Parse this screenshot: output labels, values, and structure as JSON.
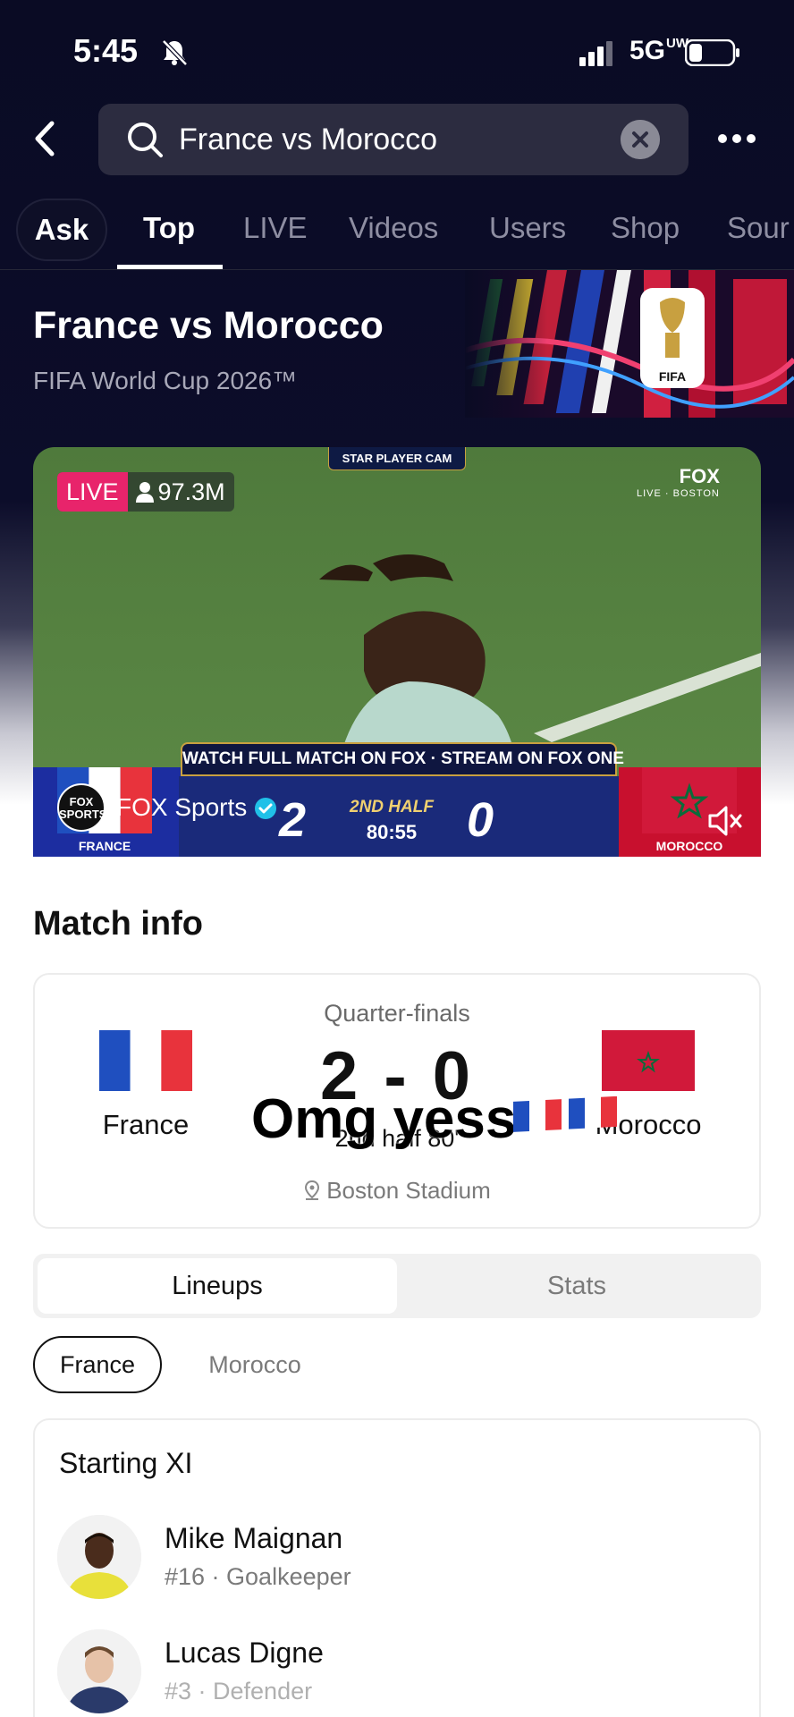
{
  "status_bar": {
    "time": "5:45",
    "network": "5G",
    "network_sup": "UW"
  },
  "search": {
    "query": "France vs Morocco"
  },
  "tabs": [
    {
      "label": "Ask"
    },
    {
      "label": "Top"
    },
    {
      "label": "LIVE"
    },
    {
      "label": "Videos"
    },
    {
      "label": "Users"
    },
    {
      "label": "Shop"
    },
    {
      "label": "Sour"
    }
  ],
  "event": {
    "title": "France vs Morocco",
    "subtitle": "FIFA World Cup 2026™",
    "banner_label": "FIFA"
  },
  "live_video": {
    "live_label": "LIVE",
    "viewers": "97.3M",
    "cam_label": "STAR PLAYER CAM",
    "broadcaster_corner": "FOX",
    "broadcaster_corner_sub": "LIVE · BOSTON",
    "watch_banner": "WATCH FULL MATCH ON FOX · STREAM ON FOX ONE",
    "home_score": "2",
    "away_score": "0",
    "period": "2ND HALF",
    "clock": "80:55",
    "home_team": "FRANCE",
    "away_team": "MOROCCO",
    "channel_logo": "FOX SPORTS",
    "channel_name": "FOX Sports"
  },
  "match_info": {
    "title": "Match info",
    "round": "Quarter-finals",
    "home_team": "France",
    "away_team": "Morocco",
    "score": "2 - 0",
    "status": "2nd half 80'",
    "venue": "Boston Stadium",
    "comment_overlay": "Omg yess"
  },
  "segments": {
    "active": "Lineups",
    "inactive": "Stats"
  },
  "team_chips": {
    "active": "France",
    "inactive": "Morocco"
  },
  "lineup": {
    "title": "Starting XI",
    "players": [
      {
        "name": "Mike Maignan",
        "meta": "#16 · Goalkeeper"
      },
      {
        "name": "Lucas Digne",
        "meta": "#3 · Defender"
      }
    ]
  },
  "colors": {
    "live_pink": "#e8246b",
    "header_bg": "#0a0b24",
    "france_blue": "#1f4fbf",
    "france_red": "#e8333c",
    "morocco_red": "#d1193a",
    "morocco_green": "#0a6b3a"
  }
}
